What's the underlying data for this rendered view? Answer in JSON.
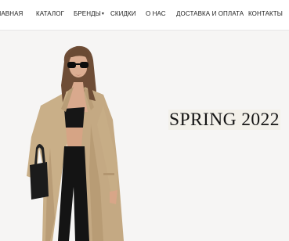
{
  "nav": {
    "items": [
      {
        "label": "ГЛАВНАЯ"
      },
      {
        "label": "КАТАЛОГ"
      },
      {
        "label": "БРЕНДЫ",
        "caret": "▾"
      },
      {
        "label": "СКИДКИ"
      },
      {
        "label": "О НАС"
      },
      {
        "label": "ДОСТАВКА И ОПЛАТА"
      },
      {
        "label": "КОНТАКТЫ"
      }
    ]
  },
  "hero": {
    "headline": "SPRING 2022",
    "image": "model-in-beige-trench-coat"
  },
  "colors": {
    "page_bg": "#ffffff",
    "hero_bg": "#f6f5f4",
    "text": "#1e1e1e",
    "coat": "#c7ad86"
  }
}
